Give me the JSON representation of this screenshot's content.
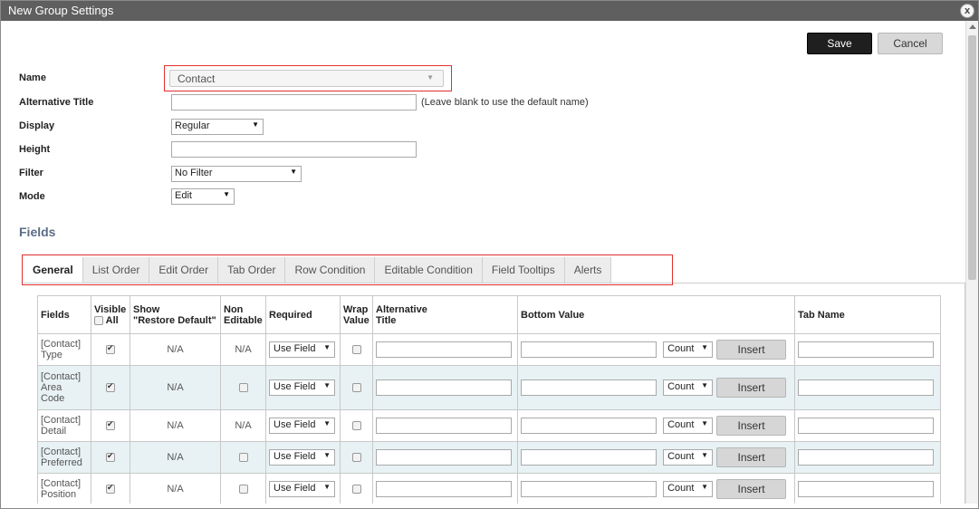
{
  "window": {
    "title": "New Group Settings",
    "close_glyph": "x"
  },
  "toolbar": {
    "save_label": "Save",
    "cancel_label": "Cancel"
  },
  "form": {
    "name_label": "Name",
    "name_value": "Contact",
    "alt_title_label": "Alternative Title",
    "alt_title_value": "",
    "alt_title_hint": "(Leave blank to use the default name)",
    "display_label": "Display",
    "display_value": "Regular",
    "height_label": "Height",
    "height_value": "",
    "filter_label": "Filter",
    "filter_value": "No Filter",
    "mode_label": "Mode",
    "mode_value": "Edit"
  },
  "fields_section": {
    "title": "Fields",
    "tabs": [
      {
        "label": "General",
        "active": true
      },
      {
        "label": "List Order",
        "active": false
      },
      {
        "label": "Edit Order",
        "active": false
      },
      {
        "label": "Tab Order",
        "active": false
      },
      {
        "label": "Row Condition",
        "active": false
      },
      {
        "label": "Editable Condition",
        "active": false
      },
      {
        "label": "Field Tooltips",
        "active": false
      },
      {
        "label": "Alerts",
        "active": false
      }
    ]
  },
  "table": {
    "headers": {
      "fields": "Fields",
      "visible": "Visible",
      "visible_all": "All",
      "show": "Show",
      "restore_default": "\"Restore Default\"",
      "non": "Non",
      "editable": "Editable",
      "required": "Required",
      "wrap": "Wrap",
      "value": "Value",
      "alternative": "Alternative",
      "title": "Title",
      "bottom_value": "Bottom Value",
      "tab_name": "Tab Name"
    },
    "rows": [
      {
        "field_line1": "[Contact]",
        "field_line2": "Type",
        "field_line3": "",
        "visible": true,
        "restore": "N/A",
        "non_editable": "N/A",
        "required": "Use Field",
        "wrap": false,
        "bottom_agg": "Count",
        "insert": "Insert"
      },
      {
        "field_line1": "[Contact]",
        "field_line2": "Area",
        "field_line3": "Code",
        "visible": true,
        "restore": "N/A",
        "non_editable": "",
        "required": "Use Field",
        "wrap": false,
        "bottom_agg": "Count",
        "insert": "Insert"
      },
      {
        "field_line1": "[Contact]",
        "field_line2": "Detail",
        "field_line3": "",
        "visible": true,
        "restore": "N/A",
        "non_editable": "N/A",
        "required": "Use Field",
        "wrap": false,
        "bottom_agg": "Count",
        "insert": "Insert"
      },
      {
        "field_line1": "[Contact]",
        "field_line2": "Preferred",
        "field_line3": "",
        "visible": true,
        "restore": "N/A",
        "non_editable": "",
        "required": "Use Field",
        "wrap": false,
        "bottom_agg": "Count",
        "insert": "Insert"
      },
      {
        "field_line1": "[Contact]",
        "field_line2": "Position",
        "field_line3": "",
        "visible": true,
        "restore": "N/A",
        "non_editable": "",
        "required": "Use Field",
        "wrap": false,
        "bottom_agg": "Count",
        "insert": "Insert"
      }
    ]
  },
  "colors": {
    "title_bar": "#5f5f5f",
    "highlight_border": "#e03030",
    "section_title": "#5a6e87",
    "alt_row": "#e8f2f4"
  }
}
